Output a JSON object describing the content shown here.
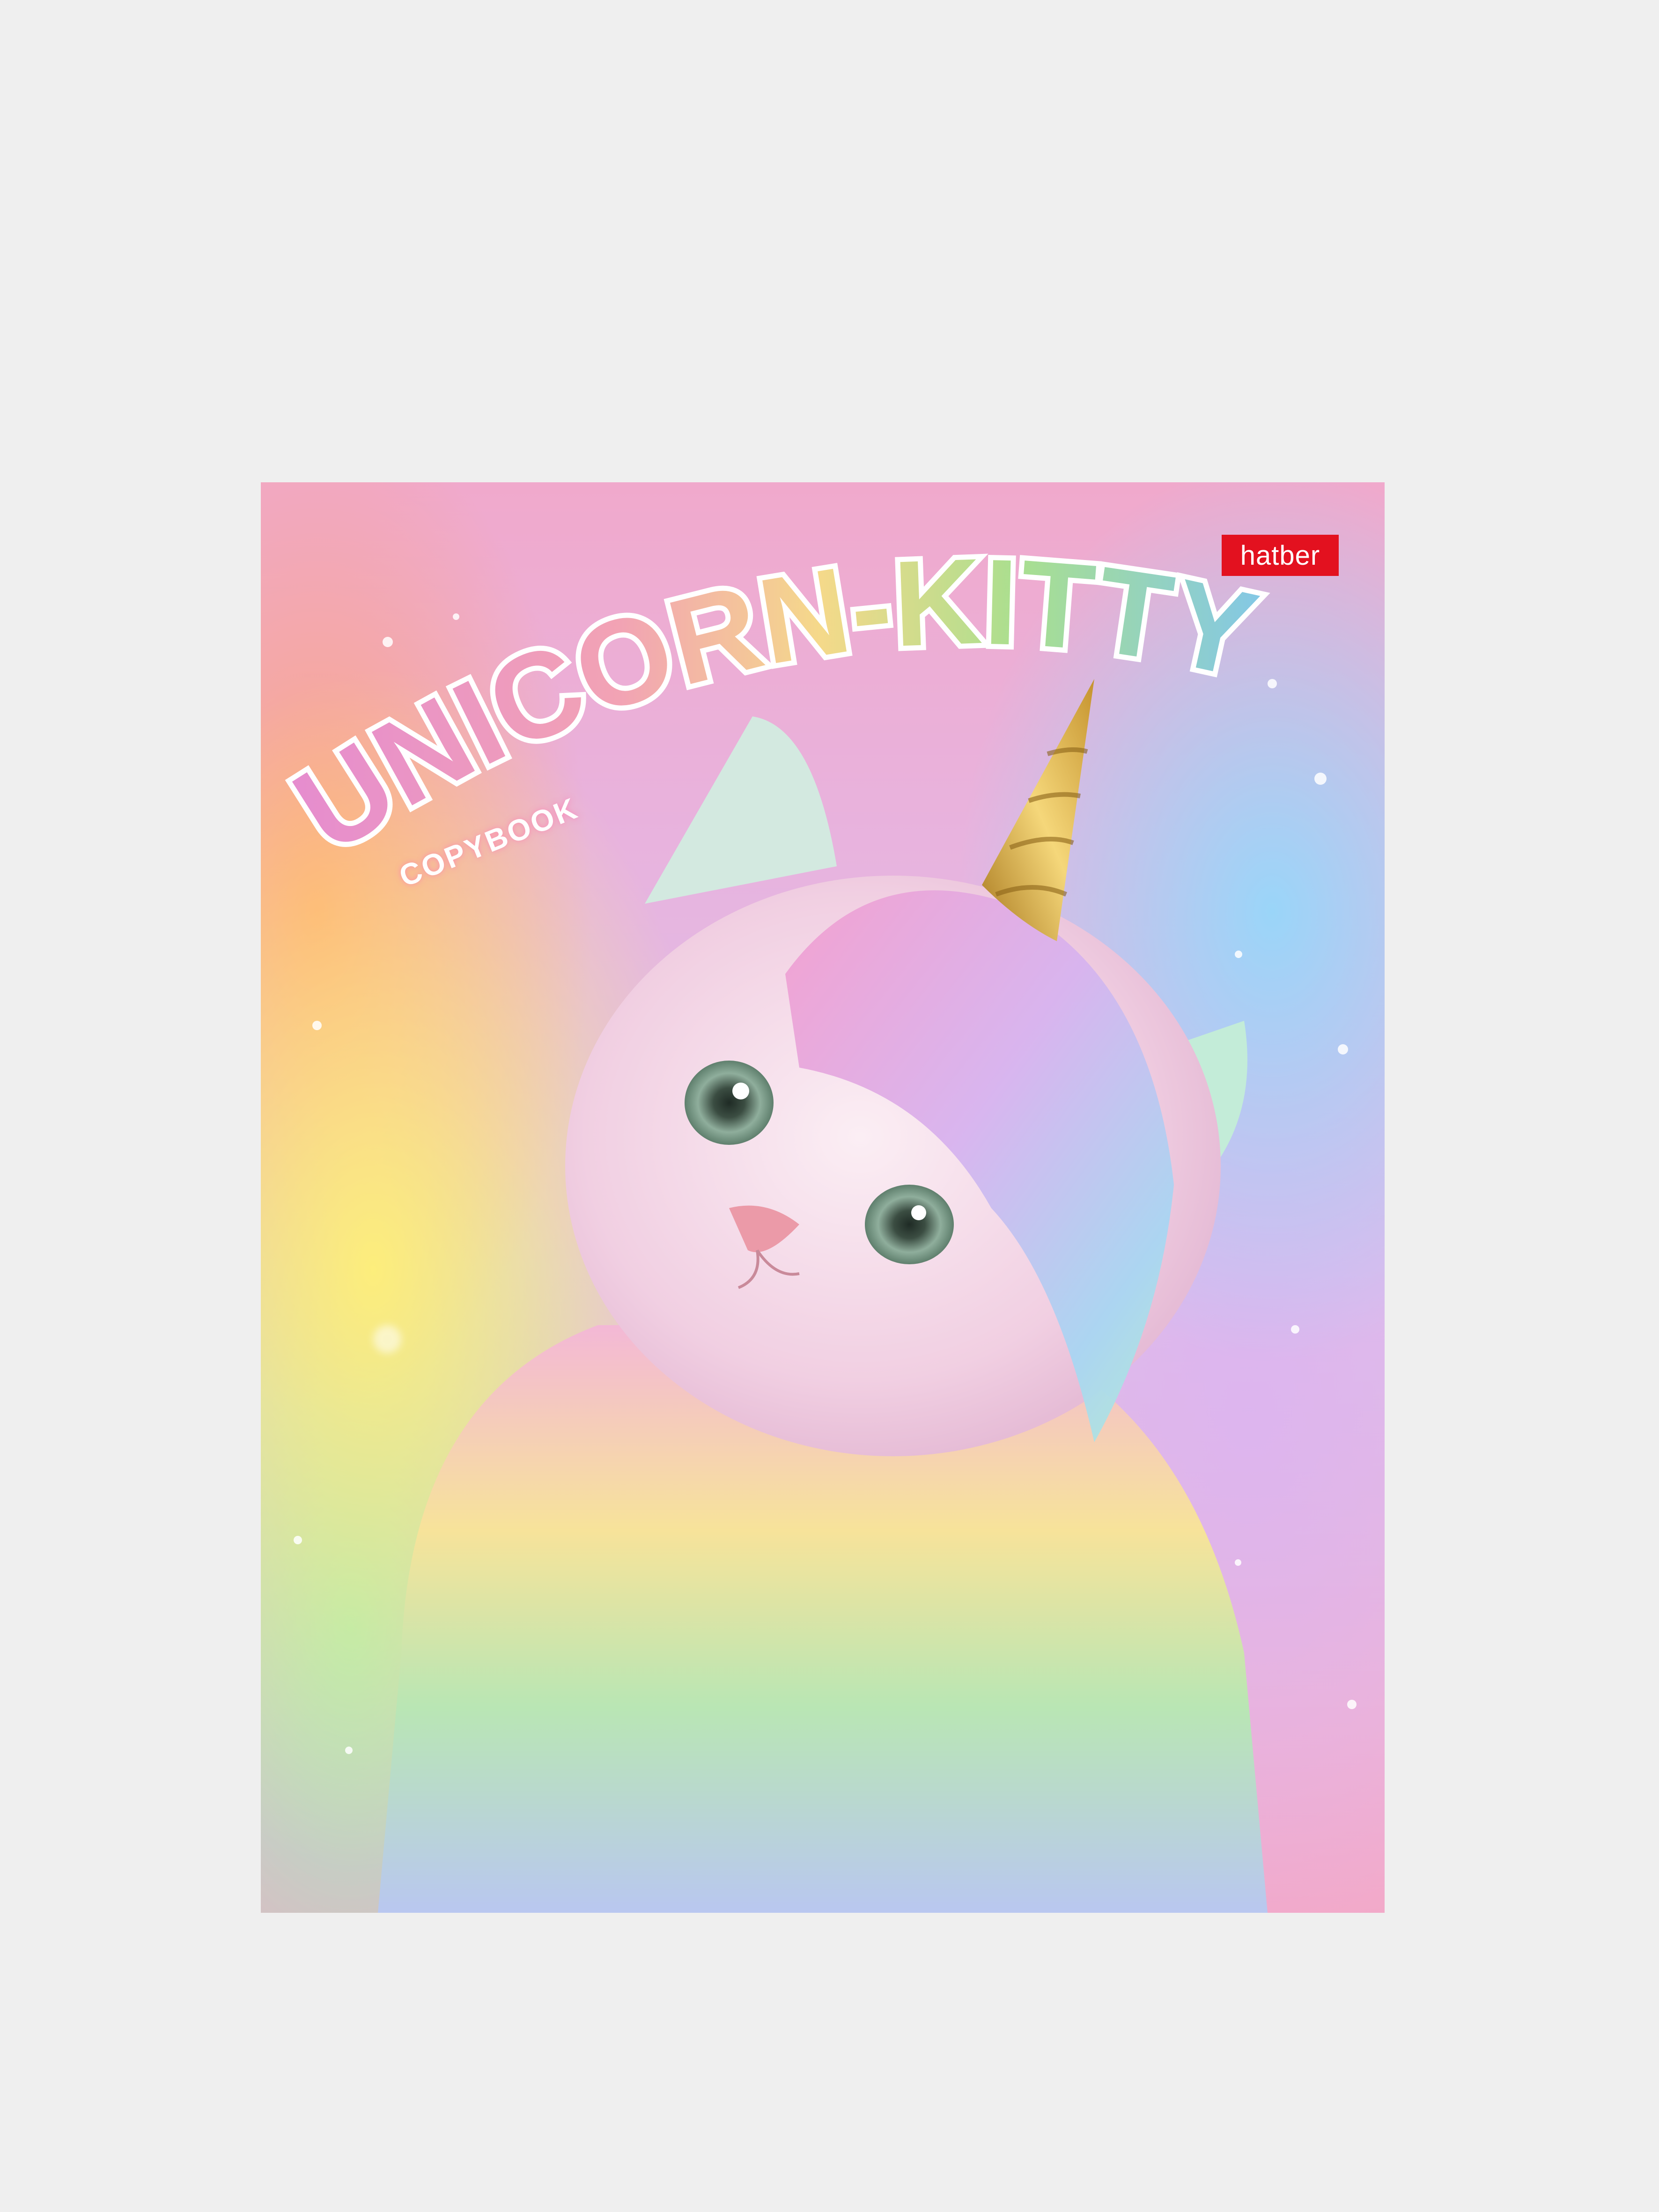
{
  "cover": {
    "brand_label": "hatber",
    "title": "UNICORN-KITTY",
    "subtitle": "COPYBOOK"
  },
  "colors": {
    "page_background": "#efefef",
    "brand_red": "#e3111f",
    "horn_gold": "#d4a93b"
  },
  "illustration": "kitten-with-unicorn-horn"
}
